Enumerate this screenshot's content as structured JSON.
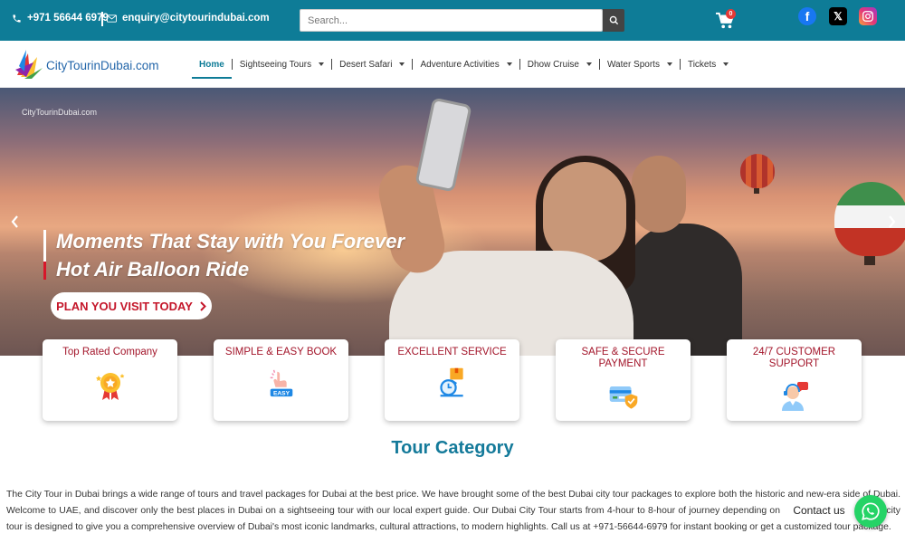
{
  "topbar": {
    "phone": "+971 56644 6979",
    "email": "enquiry@citytourindubai.com",
    "search_placeholder": "Search...",
    "cart_count": "0"
  },
  "brand": {
    "logo_text": "CityTourinDubai.com",
    "colors": {
      "primary": "#0e7c97",
      "accent_red": "#c4162a"
    }
  },
  "nav": {
    "items": [
      {
        "label": "Home",
        "dropdown": false
      },
      {
        "label": "Sightseeing Tours",
        "dropdown": true
      },
      {
        "label": "Desert Safari",
        "dropdown": true
      },
      {
        "label": "Adventure Activities",
        "dropdown": true
      },
      {
        "label": "Dhow Cruise",
        "dropdown": true
      },
      {
        "label": "Water Sports",
        "dropdown": true
      },
      {
        "label": "Tickets",
        "dropdown": true
      }
    ]
  },
  "hero": {
    "logo_text": "CityTourinDubai.com",
    "line1": "Moments That Stay with You Forever",
    "line2": "Hot Air Balloon Ride",
    "cta": "PLAN YOU VISIT TODAY"
  },
  "features": [
    {
      "title": "Top Rated Company",
      "icon": "award-icon"
    },
    {
      "title": "SIMPLE & EASY BOOK",
      "icon": "easy-hand-icon"
    },
    {
      "title": "EXCELLENT SERVICE",
      "icon": "service-clock-icon"
    },
    {
      "title": "SAFE & SECURE PAYMENT",
      "icon": "secure-card-icon"
    },
    {
      "title": "24/7 CUSTOMER SUPPORT",
      "icon": "support-agent-icon"
    }
  ],
  "category": {
    "title": "Tour Category",
    "intro": "The City Tour in Dubai brings a wide range of tours and travel packages for Dubai at the best price. We have brought some of the best Dubai city tour packages to explore both the historic and new-era side of Dubai. Welcome to UAE, and discover only the best places in Dubai on a sightseeing tour with our local expert guide. Our Dubai City Tour starts from 4-hour to 8-hour of journey depending on the package. Our Dubai city tour is designed to give you a comprehensive overview of Dubai's most iconic landmarks, cultural attractions, to modern highlights. Call us at +971-56644-6979 for instant booking or get a customized tour package."
  },
  "whatsapp": {
    "label": "Contact us"
  }
}
